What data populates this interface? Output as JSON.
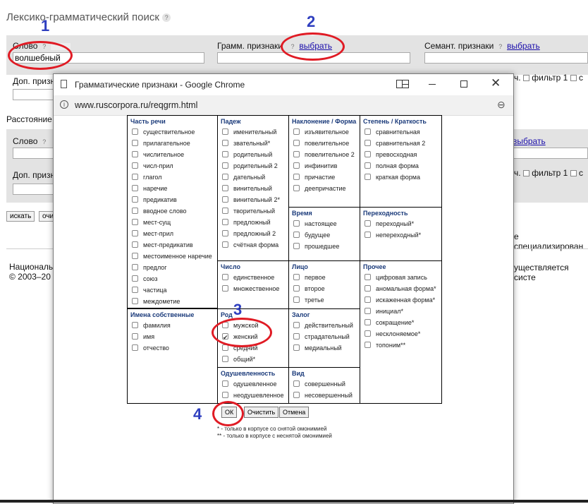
{
  "page": {
    "title": "Лексико-грамматический поиск",
    "help": "?",
    "word_label": "Слово",
    "word_value": "волшебный",
    "gramm_label": "Грамм. признаки",
    "choose_link": "выбрать",
    "semant_label": "Семант. признаки",
    "dop_label": "Доп. призн",
    "filter_label": "фильтр 1",
    "distance_label": "Расстояние",
    "word2_label": "Слово",
    "dop2_label": "Доп. призн",
    "search_btn": "искать",
    "clear_btn": "очис",
    "ch_frag": "ч.",
    "c_frag": "с",
    "spec_text": "е специализирован",
    "national_text": "Националь",
    "copyright_text": "© 2003–20",
    "carried_text": "уществляется систе"
  },
  "dialog": {
    "window_title": "Грамматические признаки - Google Chrome",
    "url": "www.ruscorpora.ru/reqgrm.html",
    "ok": "ОК",
    "clear": "Очистить",
    "cancel": "Отмена",
    "note1": "* - только в корпусе со снятой омонимией",
    "note2": "** - только в корпусе с неснятой омонимией",
    "groups": {
      "pos": {
        "title": "Часть речи",
        "items": [
          "существительное",
          "прилагательное",
          "числительное",
          "числ-прил",
          "глагол",
          "наречие",
          "предикатив",
          "вводное слово",
          "мест-сущ",
          "мест-прил",
          "мест-предикатив",
          "местоименное наречие",
          "предлог",
          "союз",
          "частица",
          "междометие"
        ]
      },
      "proper": {
        "title": "Имена собственные",
        "items": [
          "фамилия",
          "имя",
          "отчество"
        ]
      },
      "case": {
        "title": "Падеж",
        "items": [
          "именительный",
          "звательный*",
          "родительный",
          "родительный 2",
          "дательный",
          "винительный",
          "винительный 2*",
          "творительный",
          "предложный",
          "предложный 2",
          "счётная форма"
        ]
      },
      "number": {
        "title": "Число",
        "items": [
          "единственное",
          "множественное"
        ]
      },
      "gender": {
        "title": "Род",
        "items": [
          "мужской",
          "женский",
          "средний",
          "общий*"
        ],
        "checked": [
          1
        ]
      },
      "animacy": {
        "title": "Одушевленность",
        "items": [
          "одушевленное",
          "неодушевленное"
        ]
      },
      "mood": {
        "title": "Наклонение / Форма",
        "items": [
          "изъявительное",
          "повелительное",
          "повелительное 2",
          "инфинитив",
          "причастие",
          "деепричастие"
        ]
      },
      "tense": {
        "title": "Время",
        "items": [
          "настоящее",
          "будущее",
          "прошедшее"
        ]
      },
      "person": {
        "title": "Лицо",
        "items": [
          "первое",
          "второе",
          "третье"
        ]
      },
      "voice": {
        "title": "Залог",
        "items": [
          "действительный",
          "страдательный",
          "медиальный"
        ]
      },
      "aspect": {
        "title": "Вид",
        "items": [
          "совершенный",
          "несовершенный"
        ]
      },
      "degree": {
        "title": "Степень / Краткость",
        "items": [
          "сравнительная",
          "сравнительная 2",
          "превосходная",
          "полная форма",
          "краткая форма"
        ]
      },
      "transitivity": {
        "title": "Переходность",
        "items": [
          "переходный*",
          "непереходный*"
        ]
      },
      "other": {
        "title": "Прочее",
        "items": [
          "цифровая запись",
          "аномальная форма*",
          "искаженная форма*",
          "инициал*",
          "сокращение*",
          "несклоняемое*",
          "топоним**"
        ]
      }
    }
  },
  "annotations": {
    "n1": "1",
    "n2": "2",
    "n3": "3",
    "n4": "4"
  },
  "colors": {
    "ring": "#e01b24",
    "number": "#2f3fbf",
    "band": "#e3e3e3"
  }
}
